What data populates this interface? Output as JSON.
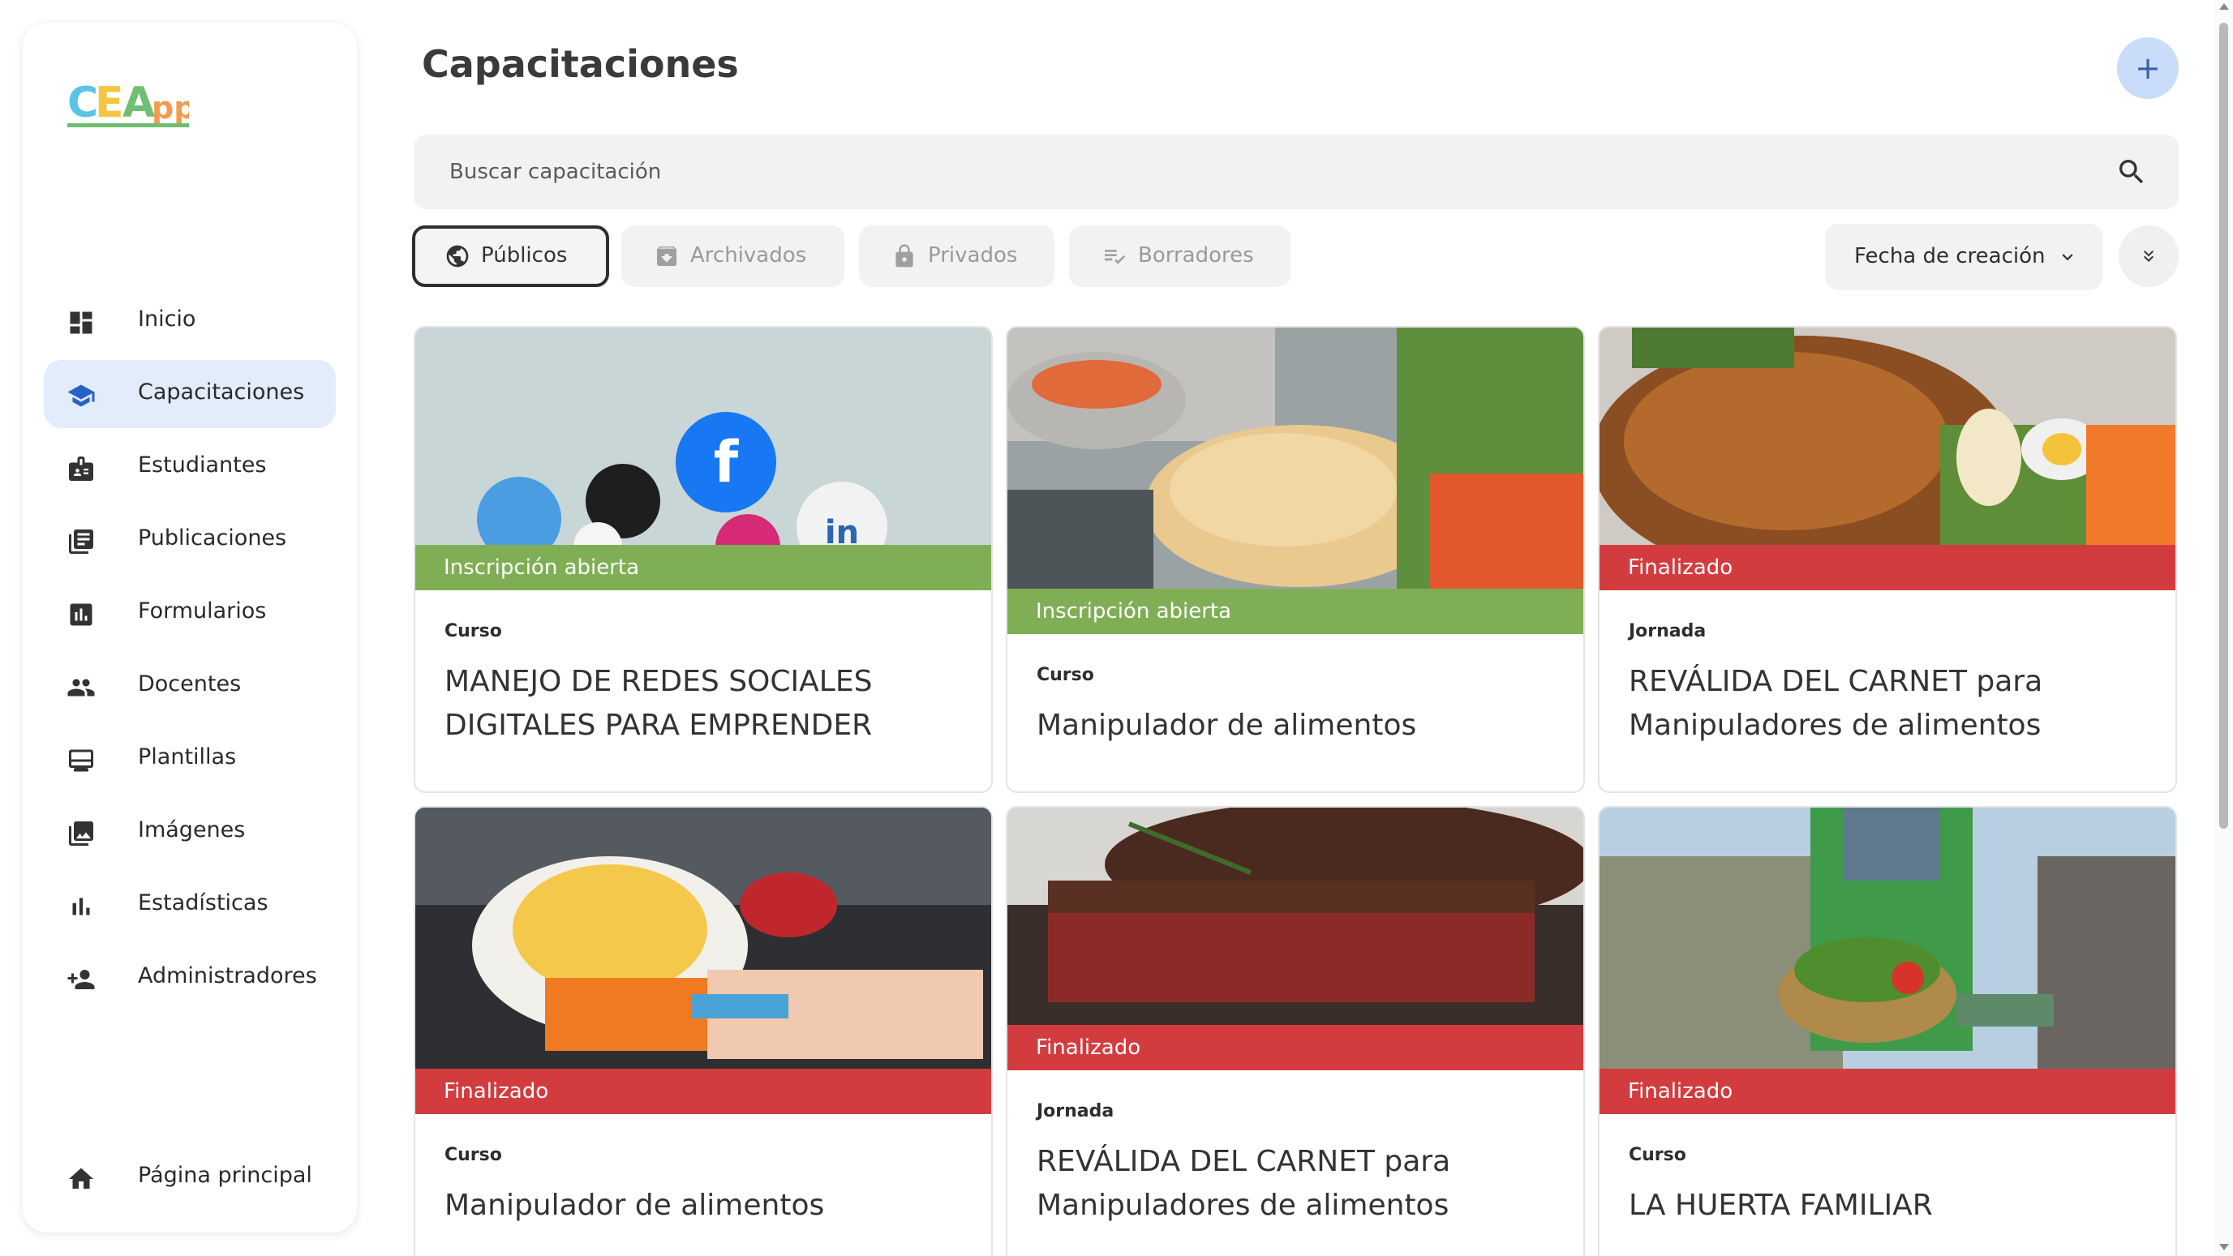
{
  "app": {
    "logo_text": "CEApp"
  },
  "sidebar": {
    "items": [
      {
        "label": "Inicio",
        "icon": "dashboard-icon",
        "active": false
      },
      {
        "label": "Capacitaciones",
        "icon": "school-icon",
        "active": true
      },
      {
        "label": "Estudiantes",
        "icon": "badge-icon",
        "active": false
      },
      {
        "label": "Publicaciones",
        "icon": "article-icon",
        "active": false
      },
      {
        "label": "Formularios",
        "icon": "poll-icon",
        "active": false
      },
      {
        "label": "Docentes",
        "icon": "people-icon",
        "active": false
      },
      {
        "label": "Plantillas",
        "icon": "template-icon",
        "active": false
      },
      {
        "label": "Imágenes",
        "icon": "image-icon",
        "active": false
      },
      {
        "label": "Estadísticas",
        "icon": "bar-chart-icon",
        "active": false
      },
      {
        "label": "Administradores",
        "icon": "person-add-icon",
        "active": false
      }
    ],
    "footer": {
      "label": "Página principal",
      "icon": "home-icon"
    }
  },
  "header": {
    "title": "Capacitaciones",
    "add_label": "+"
  },
  "search": {
    "placeholder": "Buscar capacitación",
    "value": ""
  },
  "filters": [
    {
      "label": "Públicos",
      "icon": "globe-icon",
      "active": true
    },
    {
      "label": "Archivados",
      "icon": "archive-icon",
      "active": false
    },
    {
      "label": "Privados",
      "icon": "lock-icon",
      "active": false
    },
    {
      "label": "Borradores",
      "icon": "draft-icon",
      "active": false
    }
  ],
  "sort": {
    "label": "Fecha de creación"
  },
  "cards": [
    {
      "status": "Inscripción abierta",
      "type": "Curso",
      "title": "MANEJO DE REDES SOCIALES DIGITALES PARA EMPRENDER",
      "image": "social-media-photo"
    },
    {
      "status": "Inscripción abierta",
      "type": "Curso",
      "title": "Manipulador de alimentos",
      "image": "chicken-washing-photo"
    },
    {
      "status": "Finalizado",
      "type": "Jornada",
      "title": "REVÁLIDA DEL CARNET para Manipuladores de alimentos",
      "image": "roast-chicken-photo"
    },
    {
      "status": "Finalizado",
      "type": "Curso",
      "title": "Manipulador de alimentos",
      "image": "fruit-peeling-photo"
    },
    {
      "status": "Finalizado",
      "type": "Jornada",
      "title": "REVÁLIDA DEL CARNET para Manipuladores de alimentos",
      "image": "steak-photo"
    },
    {
      "status": "Finalizado",
      "type": "Curso",
      "title": "LA HUERTA FAMILIAR",
      "image": "vegetable-basket-photo"
    }
  ],
  "colors": {
    "open": "#80ae55",
    "closed": "#d33c3f",
    "active_nav": "#e3ecfb",
    "add_button": "#c9dcfa"
  }
}
